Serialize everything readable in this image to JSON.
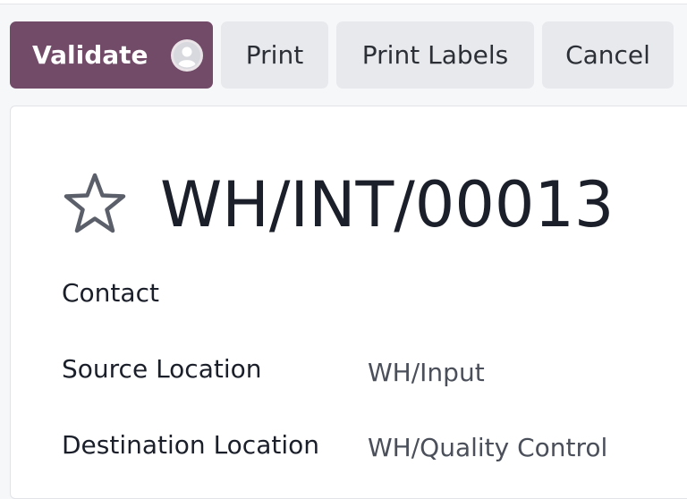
{
  "toolbar": {
    "validate_label": "Validate",
    "print_label": "Print",
    "print_labels_label": "Print Labels",
    "cancel_label": "Cancel",
    "validate_icon": "user-avatar-icon"
  },
  "record": {
    "title": "WH/INT/00013",
    "favorite_icon": "star-outline-icon"
  },
  "fields": {
    "contact": {
      "label": "Contact",
      "value": ""
    },
    "source_location": {
      "label": "Source Location",
      "value": "WH/Input"
    },
    "destination_location": {
      "label": "Destination Location",
      "value": "WH/Quality Control"
    }
  },
  "colors": {
    "primary": "#714b67",
    "secondary_button": "#e7e9ed",
    "text": "#1b1f2a",
    "muted_text": "#4a4f5a"
  }
}
